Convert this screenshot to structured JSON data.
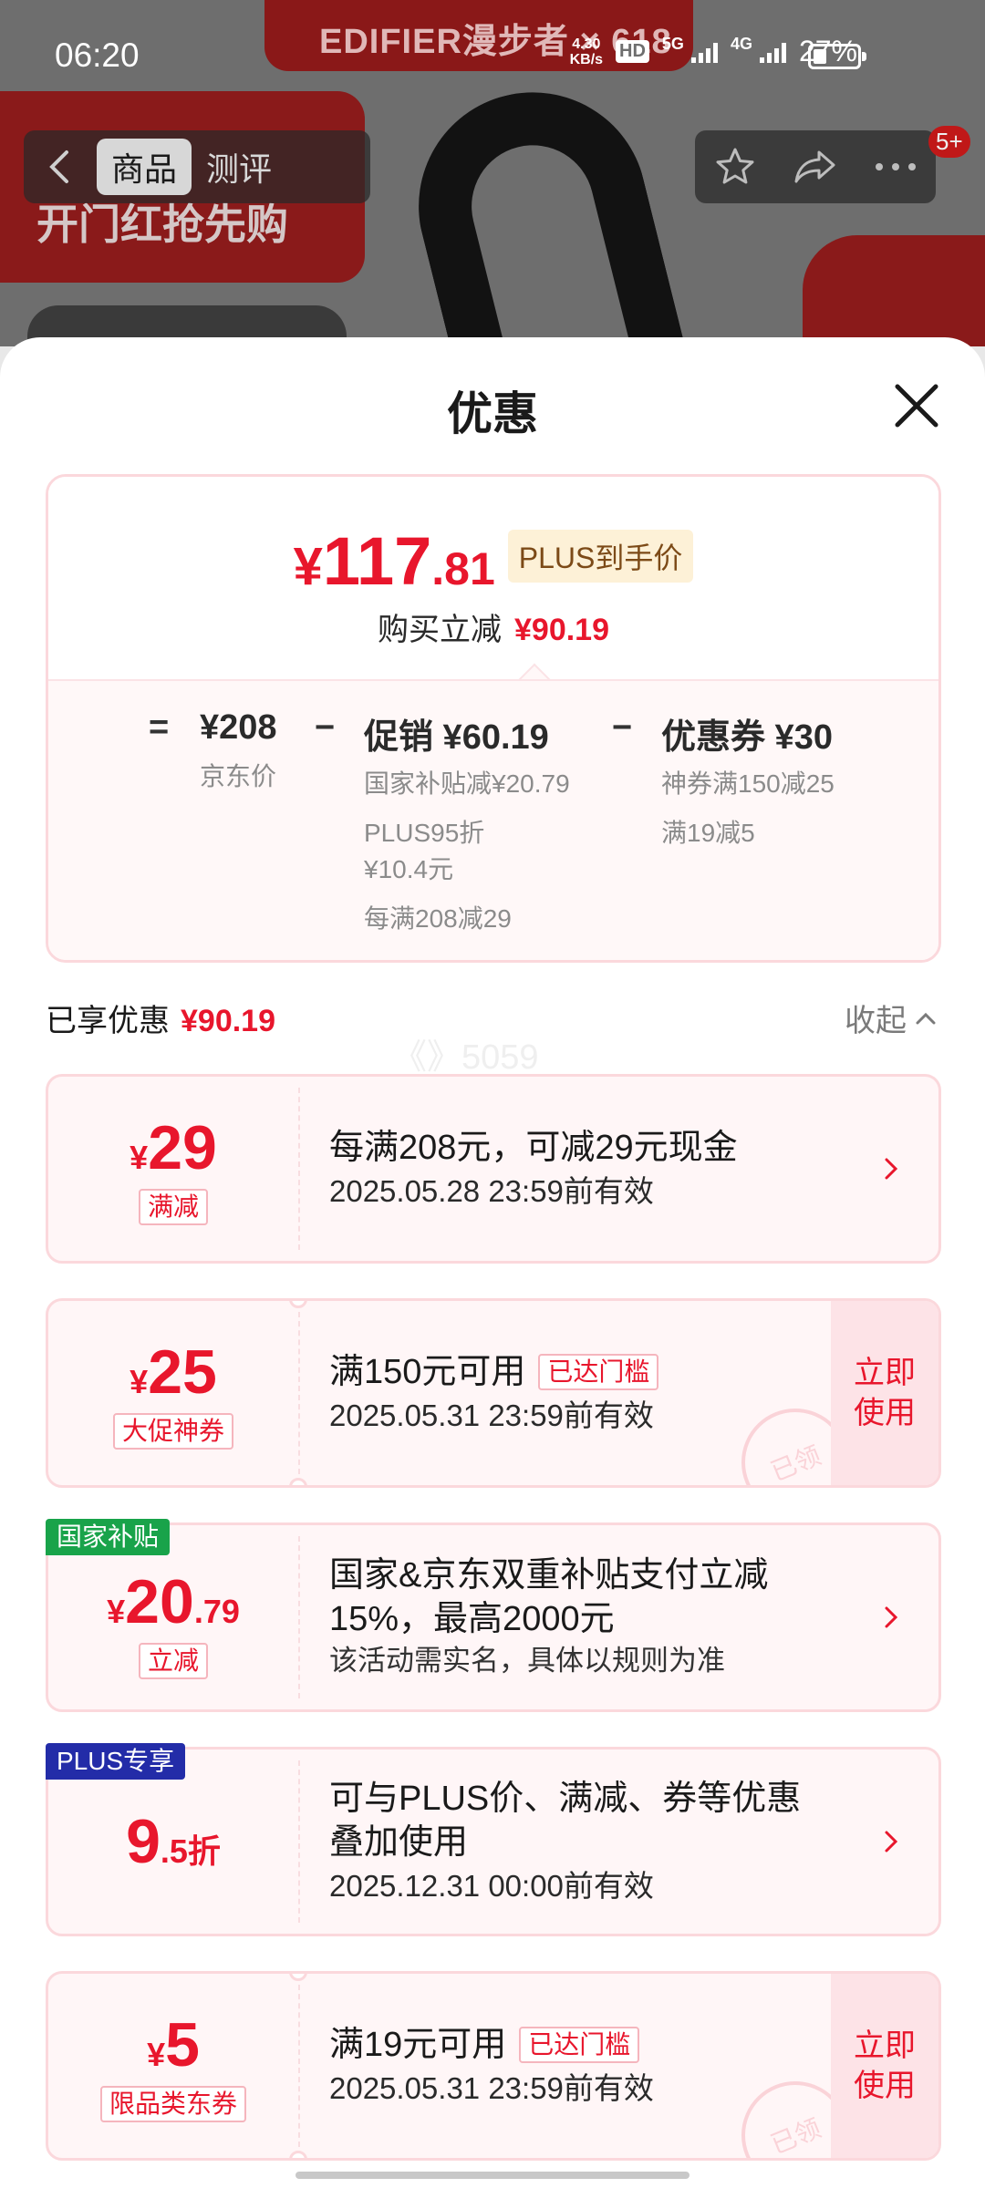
{
  "status_bar": {
    "time": "06:20",
    "net_speed_value": "4.30",
    "net_speed_unit": "KB/s",
    "hd": "HD",
    "net1": "5G",
    "net2": "4G",
    "battery": "27%"
  },
  "background": {
    "brand_text": "EDIFIER漫步者 × 618",
    "promo_text": "开门红抢先购"
  },
  "product_nav": {
    "tabs": [
      "商品",
      "测评"
    ],
    "more_badge": "5+"
  },
  "sheet": {
    "title": "优惠",
    "summary": {
      "price_symbol": "¥",
      "price_int": "117",
      "price_dec": ".81",
      "plus_tag": "PLUS到手价",
      "saving_label": "购买立减",
      "saving_amount": "¥90.19",
      "formula": {
        "eq": "=",
        "minus": "−",
        "jd_price": "¥208",
        "jd_price_label": "京东价",
        "promo_main": "促销 ¥60.19",
        "promo_subs": [
          "国家补贴减¥20.79",
          "PLUS95折",
          "¥10.4元",
          "每满208减29"
        ],
        "coupon_main": "优惠券 ¥30",
        "coupon_subs": [
          "神券满150减25",
          "满19减5"
        ]
      }
    },
    "enjoyed_label": "已享优惠",
    "enjoyed_amount": "¥90.19",
    "collapse_label": "收起",
    "watermark": "《》5059",
    "coupons": [
      {
        "symbol": "¥",
        "amount": "29",
        "tag": "满减",
        "title": "每满208元，可减29元现金",
        "sub": "2025.05.28 23:59前有效"
      },
      {
        "symbol": "¥",
        "amount": "25",
        "tag": "大促神券",
        "title": "满150元可用",
        "reached": "已达门槛",
        "sub": "2025.05.31 23:59前有效",
        "action": "立即使用",
        "stamp": "已领"
      },
      {
        "badge": "国家补贴",
        "symbol": "¥",
        "amount": "20",
        "decimal": ".79",
        "tag": "立减",
        "title": "国家&京东双重补贴支付立减15%，最高2000元",
        "note": "该活动需实名，具体以规则为准"
      },
      {
        "badge": "PLUS专享",
        "amount": "9",
        "decimal": ".5折",
        "title": "可与PLUS价、满减、券等优惠叠加使用",
        "sub": "2025.12.31 00:00前有效"
      },
      {
        "symbol": "¥",
        "amount": "5",
        "tag": "限品类东券",
        "title": "满19元可用",
        "reached": "已达门槛",
        "sub": "2025.05.31 23:59前有效",
        "action": "立即使用",
        "stamp": "已领"
      }
    ]
  }
}
